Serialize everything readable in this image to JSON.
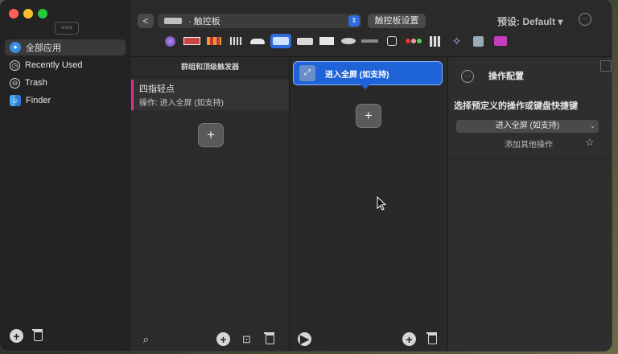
{
  "sidebar": {
    "collapse_label": "<<<",
    "items": [
      {
        "label": "全部应用",
        "icon": "all-apps-icon",
        "active": true
      },
      {
        "label": "Recently Used",
        "icon": "recent-icon",
        "active": false
      },
      {
        "label": "Trash",
        "icon": "trash-icon",
        "active": false
      },
      {
        "label": "Finder",
        "icon": "finder-icon",
        "active": false
      }
    ]
  },
  "topbar": {
    "back_label": "<",
    "device_label": "· 触控板",
    "settings_label": "触控板设置",
    "preset_label": "预设: Default ▾",
    "more_label": "···"
  },
  "triggers_column": {
    "title": "群组和顶级触发器",
    "trigger_name": "四指轻点",
    "trigger_action": "操作: 进入全屏 (如支持)"
  },
  "actions_column": {
    "action_label": "进入全屏 (如支持)"
  },
  "config_panel": {
    "title": "操作配置",
    "section_label": "选择预定义的操作或键盘快捷键",
    "selected_action": "进入全屏 (如支持)",
    "add_other": "添加其他操作",
    "more_label": "···"
  },
  "colors": {
    "accent": "#2f6ce0",
    "trigger_marker": "#d6398b",
    "window_bg": "#262626"
  }
}
